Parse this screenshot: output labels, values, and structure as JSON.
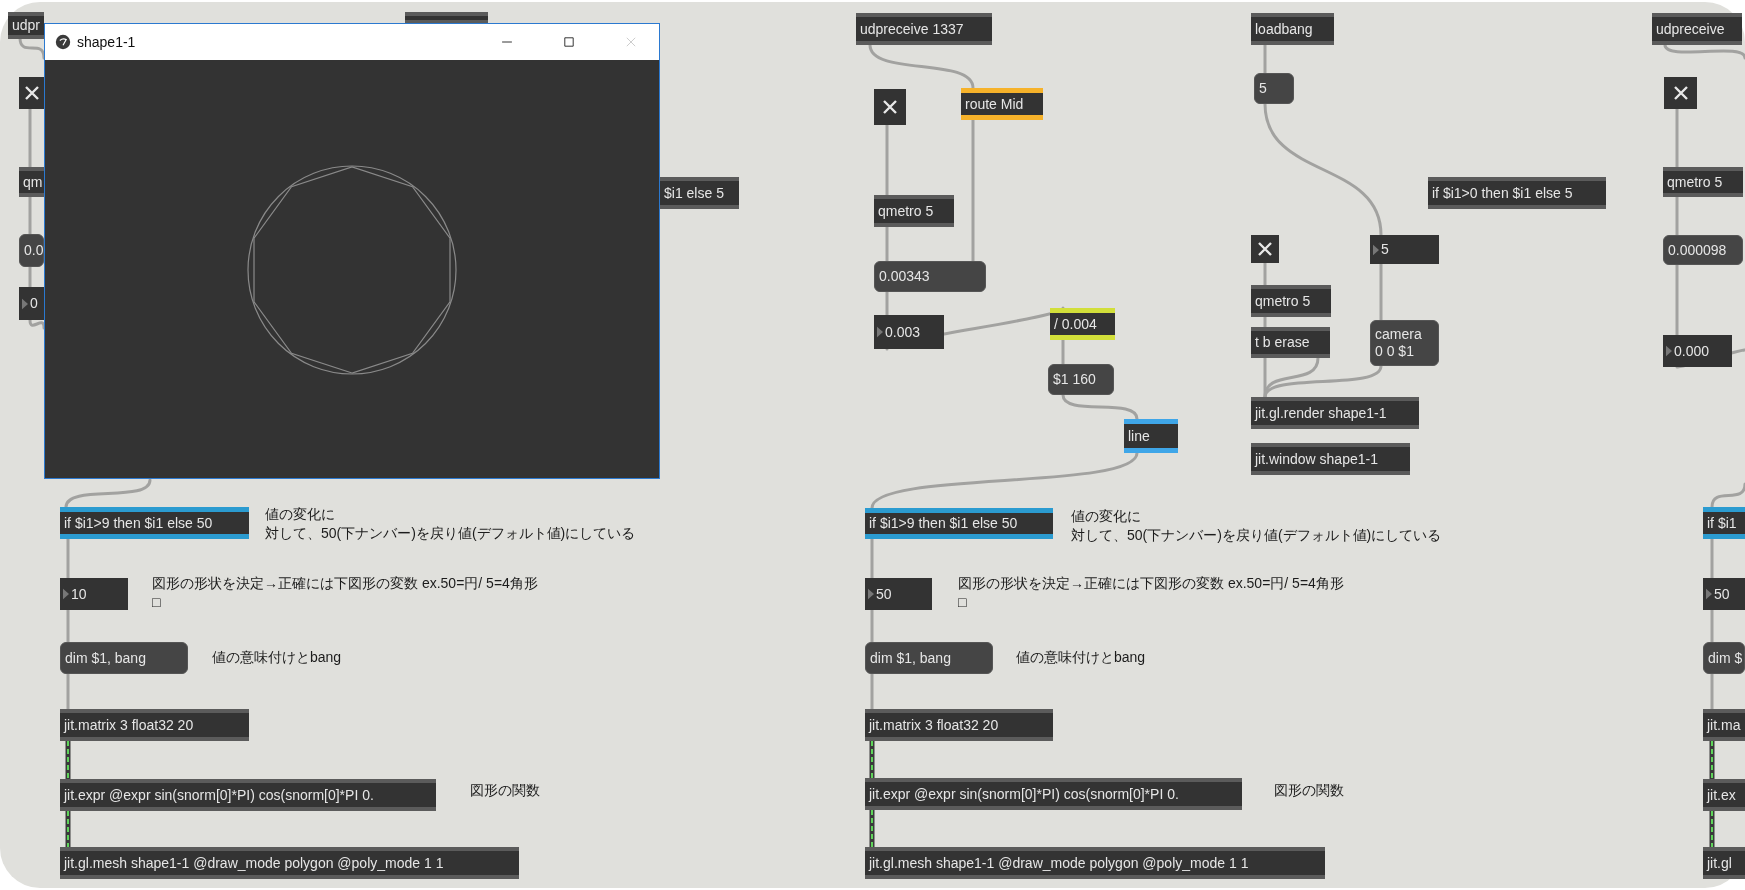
{
  "window": {
    "title": "shape1-1"
  },
  "patch": {
    "objects": [
      {
        "kind": "object",
        "text": "udpr"
      },
      {
        "kind": "object"
      },
      {
        "kind": "toggle",
        "checked": true
      },
      {
        "kind": "object",
        "text": "qm"
      },
      {
        "kind": "message",
        "text": "0.0"
      },
      {
        "kind": "number",
        "text": "0"
      },
      {
        "kind": "object",
        "text": "$i1 else 5"
      },
      {
        "kind": "object",
        "text": "if $i1>9 then $i1 else 50",
        "color": "#2b9bd0"
      },
      {
        "kind": "comment",
        "lines": [
          "値の変化に",
          "対して、50(下ナンバー)を戻り値(デフォルト値)にしている"
        ]
      },
      {
        "kind": "number",
        "text": "10"
      },
      {
        "kind": "comment",
        "lines": [
          "図形の形状を決定→正確には下図形の変数 ex.50=円/ 5=4角形",
          "□"
        ]
      },
      {
        "kind": "message",
        "text": "dim $1, bang"
      },
      {
        "kind": "comment",
        "text": "値の意味付けとbang"
      },
      {
        "kind": "object",
        "text": "jit.matrix 3 float32 20"
      },
      {
        "kind": "object",
        "text": "jit.expr @expr sin(snorm[0]*PI) cos(snorm[0]*PI 0."
      },
      {
        "kind": "comment",
        "text": "図形の関数"
      },
      {
        "kind": "object",
        "text": "jit.gl.mesh shape1-1 @draw_mode polygon @poly_mode 1 1"
      },
      {
        "kind": "object",
        "text": "udpreceive 1337"
      },
      {
        "kind": "object",
        "text": "route Mid",
        "color": "#f6b22a"
      },
      {
        "kind": "toggle",
        "checked": true
      },
      {
        "kind": "object",
        "text": "qmetro 5"
      },
      {
        "kind": "message",
        "text": "0.00343"
      },
      {
        "kind": "number",
        "text": "0.003"
      },
      {
        "kind": "object",
        "text": "/ 0.004",
        "color": "#d2df3a"
      },
      {
        "kind": "message",
        "text": "$1 160"
      },
      {
        "kind": "object",
        "text": "line",
        "color": "#3fa6e8"
      },
      {
        "kind": "object",
        "text": "loadbang"
      },
      {
        "kind": "message",
        "text": "5"
      },
      {
        "kind": "object",
        "text": "if $i1>0 then $i1 else 5"
      },
      {
        "kind": "toggle",
        "checked": true
      },
      {
        "kind": "number",
        "text": "5"
      },
      {
        "kind": "object",
        "text": "qmetro 5"
      },
      {
        "kind": "object",
        "text": "t b erase"
      },
      {
        "kind": "message",
        "text": "camera\n0 0 $1"
      },
      {
        "kind": "object",
        "text": "jit.gl.render shape1-1"
      },
      {
        "kind": "object",
        "text": "jit.window shape1-1"
      },
      {
        "kind": "object",
        "text": "if $i1>9 then $i1 else 50",
        "color": "#2b9bd0"
      },
      {
        "kind": "comment",
        "lines": [
          "値の変化に",
          "対して、50(下ナンバー)を戻り値(デフォルト値)にしている"
        ]
      },
      {
        "kind": "number",
        "text": "50"
      },
      {
        "kind": "comment",
        "lines": [
          "図形の形状を決定→正確には下図形の変数 ex.50=円/ 5=4角形",
          "□"
        ]
      },
      {
        "kind": "message",
        "text": "dim $1, bang"
      },
      {
        "kind": "comment",
        "text": "値の意味付けとbang"
      },
      {
        "kind": "object",
        "text": "jit.matrix 3 float32 20"
      },
      {
        "kind": "object",
        "text": "jit.expr @expr sin(snorm[0]*PI) cos(snorm[0]*PI 0."
      },
      {
        "kind": "comment",
        "text": "図形の関数"
      },
      {
        "kind": "object",
        "text": "jit.gl.mesh shape1-1 @draw_mode polygon @poly_mode 1 1"
      },
      {
        "kind": "object",
        "text": "udpreceive"
      },
      {
        "kind": "toggle",
        "checked": true
      },
      {
        "kind": "object",
        "text": "qmetro 5"
      },
      {
        "kind": "message",
        "text": "0.000098"
      },
      {
        "kind": "number",
        "text": "0.000"
      },
      {
        "kind": "object",
        "text": "if $i1",
        "color": "#2b9bd0"
      },
      {
        "kind": "number",
        "text": "50"
      },
      {
        "kind": "message",
        "text": "dim $"
      },
      {
        "kind": "object",
        "text": "jit.ma"
      },
      {
        "kind": "object",
        "text": "jit.ex"
      },
      {
        "kind": "object",
        "text": "jit.gl"
      }
    ]
  }
}
